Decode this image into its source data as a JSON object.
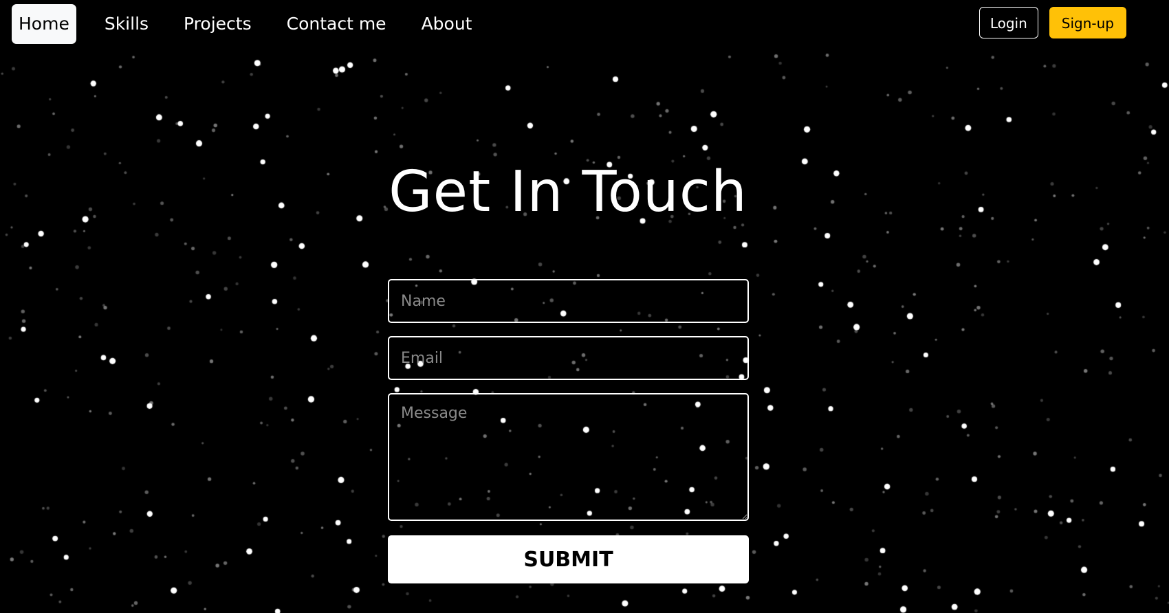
{
  "nav": {
    "items": [
      {
        "label": "Home",
        "active": true
      },
      {
        "label": "Skills"
      },
      {
        "label": "Projects"
      },
      {
        "label": "Contact me"
      },
      {
        "label": "About"
      }
    ],
    "login_label": "Login",
    "signup_label": "Sign-up"
  },
  "contact": {
    "title": "Get In Touch",
    "name_placeholder": "Name",
    "email_placeholder": "Email",
    "message_placeholder": "Message",
    "submit_label": "SUBMIT"
  },
  "colors": {
    "background": "#000000",
    "signup_accent": "#ffc107",
    "nav_active_bg": "#f8f9fa"
  }
}
